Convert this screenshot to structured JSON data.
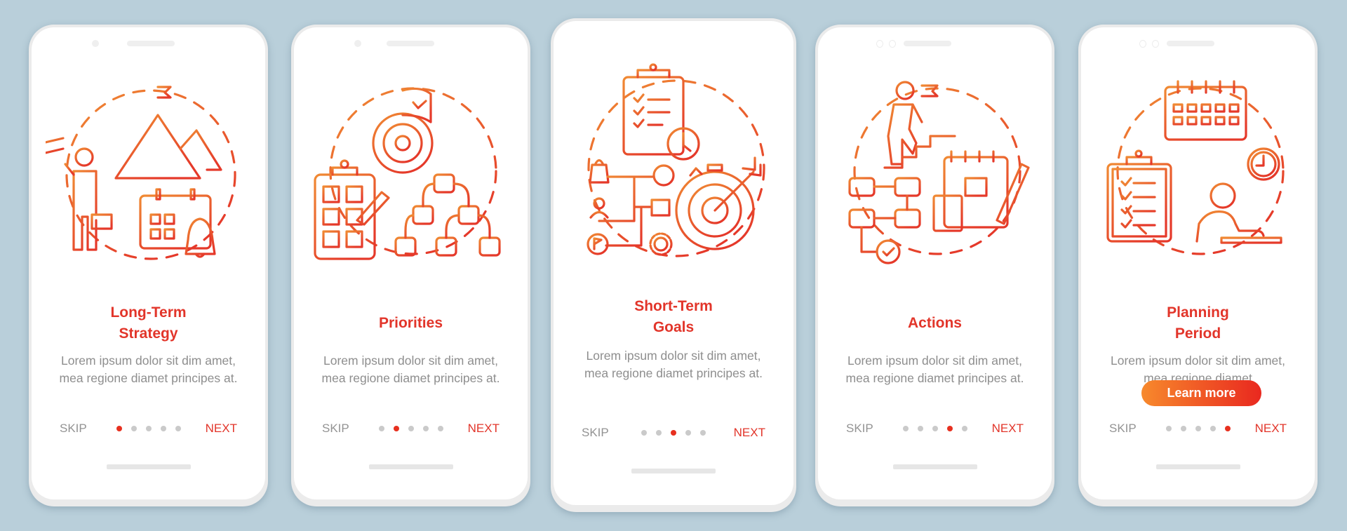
{
  "colors": {
    "background": "#b9cfda",
    "accent": "#e2352a",
    "gradient_start": "#f7892c",
    "gradient_end": "#e9281f",
    "body_text": "#8e8e8e",
    "inactive_dot": "#cacaca"
  },
  "screens": [
    {
      "icon": "long-term-strategy-illustration",
      "title_line1": "Long-Term",
      "title_line2": "Strategy",
      "description": "Lorem ipsum dolor sit dim amet, mea regione diamet principes at.",
      "skip_label": "SKIP",
      "next_label": "NEXT",
      "page_index": 1,
      "page_count": 5
    },
    {
      "icon": "priorities-illustration",
      "title_line1": "Priorities",
      "description": "Lorem ipsum dolor sit dim amet, mea regione diamet principes at.",
      "skip_label": "SKIP",
      "next_label": "NEXT",
      "page_index": 2,
      "page_count": 5
    },
    {
      "icon": "short-term-goals-illustration",
      "title_line1": "Short-Term",
      "title_line2": "Goals",
      "description": "Lorem ipsum dolor sit dim amet, mea regione diamet principes at.",
      "skip_label": "SKIP",
      "next_label": "NEXT",
      "page_index": 3,
      "page_count": 5
    },
    {
      "icon": "actions-illustration",
      "title_line1": "Actions",
      "description": "Lorem ipsum dolor sit dim amet, mea regione diamet principes at.",
      "skip_label": "SKIP",
      "next_label": "NEXT",
      "page_index": 4,
      "page_count": 5
    },
    {
      "icon": "planning-period-illustration",
      "title_line1": "Planning",
      "title_line2": "Period",
      "description": "Lorem ipsum dolor sit dim amet, mea regione diamet",
      "button_label": "Learn more",
      "skip_label": "SKIP",
      "next_label": "NEXT",
      "page_index": 5,
      "page_count": 5
    }
  ]
}
